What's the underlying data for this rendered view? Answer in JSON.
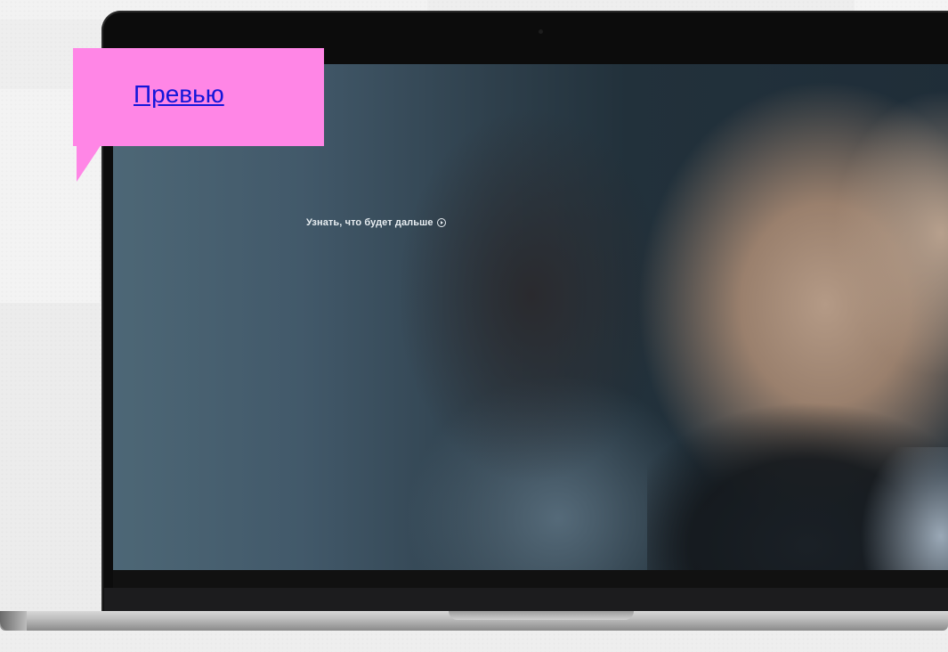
{
  "badge": {
    "label": "Превью",
    "color": "#ff86e6",
    "link_color": "#1316d9"
  },
  "video": {
    "cta_label": "Узнать, что будет дальше",
    "cta_icon": "play-circle-icon"
  },
  "device": {
    "type": "laptop",
    "icon": "laptop-frame"
  }
}
